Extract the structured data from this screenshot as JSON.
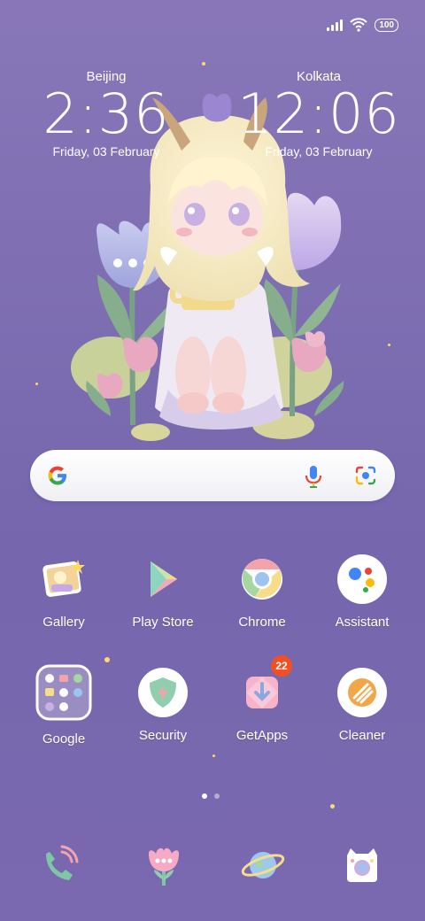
{
  "status": {
    "battery": "100"
  },
  "clocks": [
    {
      "city": "Beijing",
      "time": "2:36",
      "date": "Friday, 03 February"
    },
    {
      "city": "Kolkata",
      "time": "12:06",
      "date": "Friday, 03 February"
    }
  ],
  "search": {
    "logo_icon": "google-g-icon",
    "mic_icon": "mic-icon",
    "lens_icon": "lens-icon"
  },
  "apps_row1": [
    {
      "label": "Gallery",
      "icon": "gallery-icon"
    },
    {
      "label": "Play Store",
      "icon": "play-store-icon"
    },
    {
      "label": "Chrome",
      "icon": "chrome-icon"
    },
    {
      "label": "Assistant",
      "icon": "assistant-icon"
    }
  ],
  "apps_row2": [
    {
      "label": "Google",
      "icon": "folder-icon"
    },
    {
      "label": "Security",
      "icon": "security-icon"
    },
    {
      "label": "GetApps",
      "icon": "getapps-icon",
      "badge": "22"
    },
    {
      "label": "Cleaner",
      "icon": "cleaner-icon"
    }
  ],
  "dock": [
    "phone-icon",
    "tulip-icon",
    "planet-icon",
    "camera-cat-icon"
  ],
  "page_indicator": {
    "count": 2,
    "active": 0
  },
  "colors": {
    "accent_badge": "#f25022",
    "wallpaper": "#7d6db1"
  }
}
